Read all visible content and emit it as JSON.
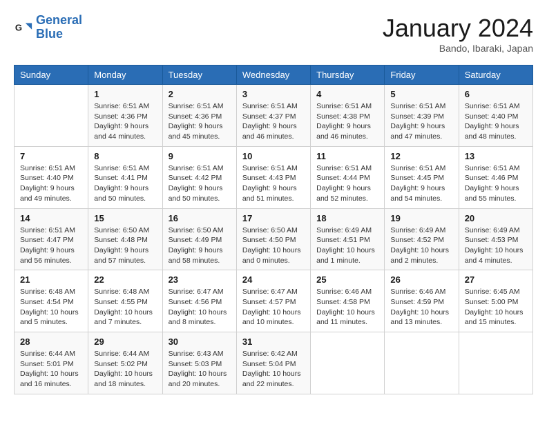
{
  "logo": {
    "line1": "General",
    "line2": "Blue"
  },
  "title": "January 2024",
  "subtitle": "Bando, Ibaraki, Japan",
  "weekdays": [
    "Sunday",
    "Monday",
    "Tuesday",
    "Wednesday",
    "Thursday",
    "Friday",
    "Saturday"
  ],
  "weeks": [
    [
      {
        "day": "",
        "info": ""
      },
      {
        "day": "1",
        "info": "Sunrise: 6:51 AM\nSunset: 4:36 PM\nDaylight: 9 hours\nand 44 minutes."
      },
      {
        "day": "2",
        "info": "Sunrise: 6:51 AM\nSunset: 4:36 PM\nDaylight: 9 hours\nand 45 minutes."
      },
      {
        "day": "3",
        "info": "Sunrise: 6:51 AM\nSunset: 4:37 PM\nDaylight: 9 hours\nand 46 minutes."
      },
      {
        "day": "4",
        "info": "Sunrise: 6:51 AM\nSunset: 4:38 PM\nDaylight: 9 hours\nand 46 minutes."
      },
      {
        "day": "5",
        "info": "Sunrise: 6:51 AM\nSunset: 4:39 PM\nDaylight: 9 hours\nand 47 minutes."
      },
      {
        "day": "6",
        "info": "Sunrise: 6:51 AM\nSunset: 4:40 PM\nDaylight: 9 hours\nand 48 minutes."
      }
    ],
    [
      {
        "day": "7",
        "info": "Sunrise: 6:51 AM\nSunset: 4:40 PM\nDaylight: 9 hours\nand 49 minutes."
      },
      {
        "day": "8",
        "info": "Sunrise: 6:51 AM\nSunset: 4:41 PM\nDaylight: 9 hours\nand 50 minutes."
      },
      {
        "day": "9",
        "info": "Sunrise: 6:51 AM\nSunset: 4:42 PM\nDaylight: 9 hours\nand 50 minutes."
      },
      {
        "day": "10",
        "info": "Sunrise: 6:51 AM\nSunset: 4:43 PM\nDaylight: 9 hours\nand 51 minutes."
      },
      {
        "day": "11",
        "info": "Sunrise: 6:51 AM\nSunset: 4:44 PM\nDaylight: 9 hours\nand 52 minutes."
      },
      {
        "day": "12",
        "info": "Sunrise: 6:51 AM\nSunset: 4:45 PM\nDaylight: 9 hours\nand 54 minutes."
      },
      {
        "day": "13",
        "info": "Sunrise: 6:51 AM\nSunset: 4:46 PM\nDaylight: 9 hours\nand 55 minutes."
      }
    ],
    [
      {
        "day": "14",
        "info": "Sunrise: 6:51 AM\nSunset: 4:47 PM\nDaylight: 9 hours\nand 56 minutes."
      },
      {
        "day": "15",
        "info": "Sunrise: 6:50 AM\nSunset: 4:48 PM\nDaylight: 9 hours\nand 57 minutes."
      },
      {
        "day": "16",
        "info": "Sunrise: 6:50 AM\nSunset: 4:49 PM\nDaylight: 9 hours\nand 58 minutes."
      },
      {
        "day": "17",
        "info": "Sunrise: 6:50 AM\nSunset: 4:50 PM\nDaylight: 10 hours\nand 0 minutes."
      },
      {
        "day": "18",
        "info": "Sunrise: 6:49 AM\nSunset: 4:51 PM\nDaylight: 10 hours\nand 1 minute."
      },
      {
        "day": "19",
        "info": "Sunrise: 6:49 AM\nSunset: 4:52 PM\nDaylight: 10 hours\nand 2 minutes."
      },
      {
        "day": "20",
        "info": "Sunrise: 6:49 AM\nSunset: 4:53 PM\nDaylight: 10 hours\nand 4 minutes."
      }
    ],
    [
      {
        "day": "21",
        "info": "Sunrise: 6:48 AM\nSunset: 4:54 PM\nDaylight: 10 hours\nand 5 minutes."
      },
      {
        "day": "22",
        "info": "Sunrise: 6:48 AM\nSunset: 4:55 PM\nDaylight: 10 hours\nand 7 minutes."
      },
      {
        "day": "23",
        "info": "Sunrise: 6:47 AM\nSunset: 4:56 PM\nDaylight: 10 hours\nand 8 minutes."
      },
      {
        "day": "24",
        "info": "Sunrise: 6:47 AM\nSunset: 4:57 PM\nDaylight: 10 hours\nand 10 minutes."
      },
      {
        "day": "25",
        "info": "Sunrise: 6:46 AM\nSunset: 4:58 PM\nDaylight: 10 hours\nand 11 minutes."
      },
      {
        "day": "26",
        "info": "Sunrise: 6:46 AM\nSunset: 4:59 PM\nDaylight: 10 hours\nand 13 minutes."
      },
      {
        "day": "27",
        "info": "Sunrise: 6:45 AM\nSunset: 5:00 PM\nDaylight: 10 hours\nand 15 minutes."
      }
    ],
    [
      {
        "day": "28",
        "info": "Sunrise: 6:44 AM\nSunset: 5:01 PM\nDaylight: 10 hours\nand 16 minutes."
      },
      {
        "day": "29",
        "info": "Sunrise: 6:44 AM\nSunset: 5:02 PM\nDaylight: 10 hours\nand 18 minutes."
      },
      {
        "day": "30",
        "info": "Sunrise: 6:43 AM\nSunset: 5:03 PM\nDaylight: 10 hours\nand 20 minutes."
      },
      {
        "day": "31",
        "info": "Sunrise: 6:42 AM\nSunset: 5:04 PM\nDaylight: 10 hours\nand 22 minutes."
      },
      {
        "day": "",
        "info": ""
      },
      {
        "day": "",
        "info": ""
      },
      {
        "day": "",
        "info": ""
      }
    ]
  ]
}
